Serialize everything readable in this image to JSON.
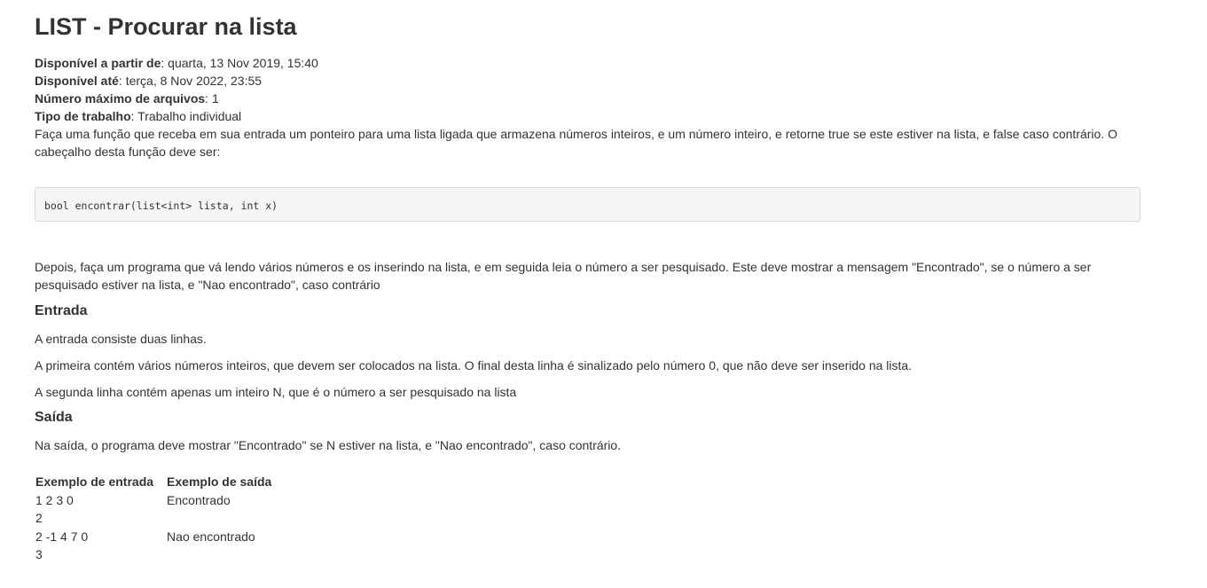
{
  "title": "LIST - Procurar na lista",
  "meta": {
    "available_from_label": "Disponível a partir de",
    "available_from_value": ": quarta, 13 Nov 2019, 15:40",
    "available_until_label": "Disponível até",
    "available_until_value": ": terça, 8 Nov 2022, 23:55",
    "max_files_label": "Número máximo de arquivos",
    "max_files_value": ": 1",
    "work_type_label": "Tipo de trabalho",
    "work_type_value": ": Trabalho individual"
  },
  "description": "Faça uma função que receba em sua entrada um ponteiro para uma lista ligada que armazena números inteiros, e um número inteiro, e retorne true se este estiver na lista, e false caso contrário. O cabeçalho desta função deve ser:",
  "code": "bool encontrar(list<int> lista, int x)",
  "description_after": "Depois, faça um programa que vá lendo vários números e os inserindo na lista, e em seguida leia o número a ser pesquisado. Este deve mostrar a mensagem \"Encontrado\", se o número a ser pesquisado estiver na lista, e \"Nao encontrado\", caso contrário",
  "input_section": {
    "heading": "Entrada",
    "p1": "A entrada consiste duas linhas.",
    "p2": "A primeira contém vários números inteiros, que devem ser colocados na lista. O final desta linha é sinalizado pelo número 0, que não deve ser inserido na lista.",
    "p3": "A segunda linha contém apenas um inteiro N, que é o número a ser pesquisado na lista"
  },
  "output_section": {
    "heading": "Saída",
    "p1": "Na saída, o programa deve mostrar \"Encontrado\" se N estiver na lista, e \"Nao encontrado\", caso contrário."
  },
  "examples": {
    "col_input": "Exemplo de entrada",
    "col_output": "Exemplo de saída",
    "rows": [
      {
        "input": "1 2 3 0\n2",
        "output": "Encontrado"
      },
      {
        "input": "2 -1 4 7 0\n3",
        "output": "Nao encontrado"
      }
    ]
  }
}
